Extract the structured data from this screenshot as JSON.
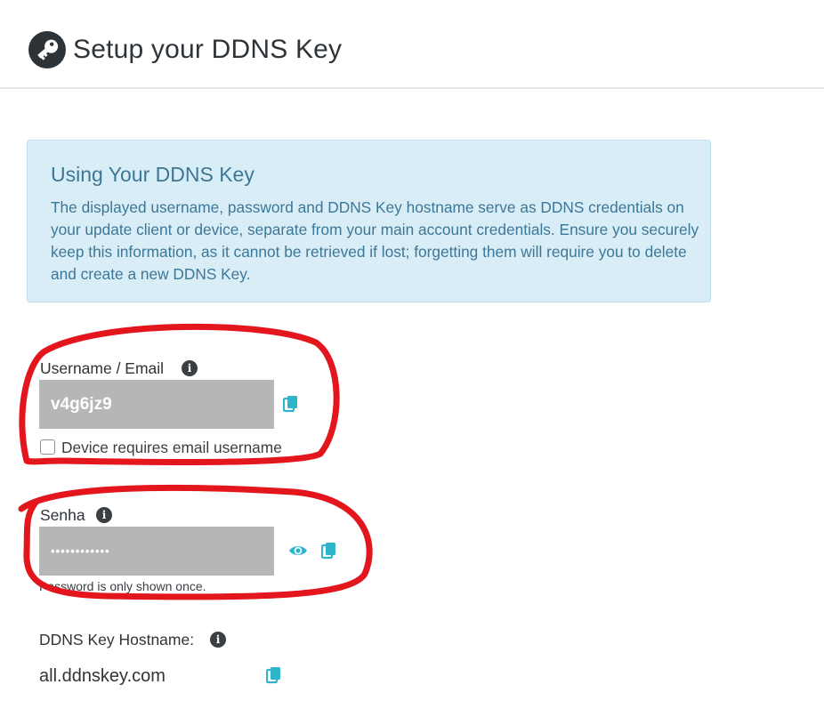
{
  "header": {
    "title": "Setup your DDNS Key",
    "icon": "key-icon"
  },
  "info_box": {
    "title": "Using Your DDNS Key",
    "text": "The displayed username, password and DDNS Key hostname serve as DDNS credentials on your update client or device, separate from your main account credentials. Ensure you securely keep this information, as it cannot be retrieved if lost; forgetting them will require you to delete and create a new DDNS Key."
  },
  "username": {
    "label": "Username / Email",
    "value": "v4g6jz9",
    "checkbox_label": "Device requires email username",
    "checkbox_checked": false
  },
  "password": {
    "label": "Senha",
    "value": "••••••••••••",
    "help": "Password is only shown once."
  },
  "hostname": {
    "label": "DDNS Key Hostname:",
    "value": "all.ddnskey.com"
  },
  "colors": {
    "accent": "#2eb5c9",
    "info_bg": "#d9edf6",
    "info_text": "#3d7798",
    "input_bg": "#b5b6b8",
    "annotation": "#e3161d"
  }
}
